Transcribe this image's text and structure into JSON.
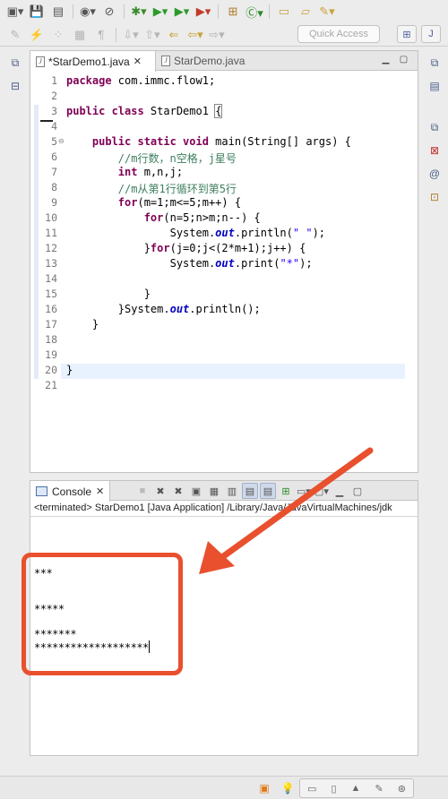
{
  "toolbar": {
    "quick_access_placeholder": "Quick Access",
    "row1_icons": [
      "new-wizard-icon",
      "save-icon",
      "save-all-icon",
      "profile-icon",
      "skip-breakpoints-icon",
      "debug-icon",
      "run-icon",
      "run-config-icon",
      "external-tools-icon",
      "new-java-package-icon",
      "new-java-class-icon",
      "open-type-icon",
      "open-task-icon",
      "search-icon"
    ],
    "row2_icons": [
      "toggle-mark-occurrences-icon",
      "toggle-block-selection-icon",
      "show-whitespace-icon",
      "next-annotation-icon",
      "previous-annotation-icon",
      "last-edit-location-icon",
      "back-icon",
      "forward-icon"
    ]
  },
  "editor": {
    "tabs": [
      {
        "label": "*StarDemo1.java",
        "active": true
      },
      {
        "label": "StarDemo.java",
        "active": false
      }
    ],
    "lines": [
      {
        "no": "1",
        "html": "<span class=\"kw\">package</span> com.immc.flow1;"
      },
      {
        "no": "2",
        "html": ""
      },
      {
        "no": "3",
        "html": "<span class=\"kw\">public class</span> StarDemo1 <span class=\"brk\">{</span>"
      },
      {
        "no": "4",
        "html": ""
      },
      {
        "no": "5",
        "html": "    <span class=\"kw\">public static void</span> main(String[] args) {"
      },
      {
        "no": "6",
        "html": "        <span class=\"cm\">//m行数，n空格，j星号</span>"
      },
      {
        "no": "7",
        "html": "        <span class=\"kw\">int</span> m,n,j;"
      },
      {
        "no": "8",
        "html": "        <span class=\"cm\">//m从第1行循环到第5行</span>"
      },
      {
        "no": "9",
        "html": "        <span class=\"kw\">for</span>(m=1;m&lt;=5;m++) {"
      },
      {
        "no": "10",
        "html": "            <span class=\"kw\">for</span>(n=5;n&gt;m;n--) {"
      },
      {
        "no": "11",
        "html": "                System.<span class=\"fld\">out</span>.println(<span class=\"st\">\" \"</span>);"
      },
      {
        "no": "12",
        "html": "            }<span class=\"kw\">for</span>(j=0;j&lt;(2*m+1);j++) {"
      },
      {
        "no": "13",
        "html": "                System.<span class=\"fld\">out</span>.print(<span class=\"st\">\"*\"</span>);"
      },
      {
        "no": "14",
        "html": ""
      },
      {
        "no": "15",
        "html": "            }"
      },
      {
        "no": "16",
        "html": "        }System.<span class=\"fld\">out</span>.println();"
      },
      {
        "no": "17",
        "html": "    }"
      },
      {
        "no": "18",
        "html": ""
      },
      {
        "no": "19",
        "html": ""
      },
      {
        "no": "20",
        "html": "}"
      },
      {
        "no": "21",
        "html": ""
      }
    ]
  },
  "console": {
    "tab_label": "Console",
    "status": "<terminated> StarDemo1 [Java Application] /Library/Java/JavaVirtualMachines/jdk",
    "output_lines": [
      "***",
      "*****",
      "*******",
      "*******************"
    ]
  },
  "colors": {
    "annotation": "#e8502e",
    "keyword": "#7f0055",
    "comment": "#3f7f5f",
    "string": "#2a00ff"
  }
}
